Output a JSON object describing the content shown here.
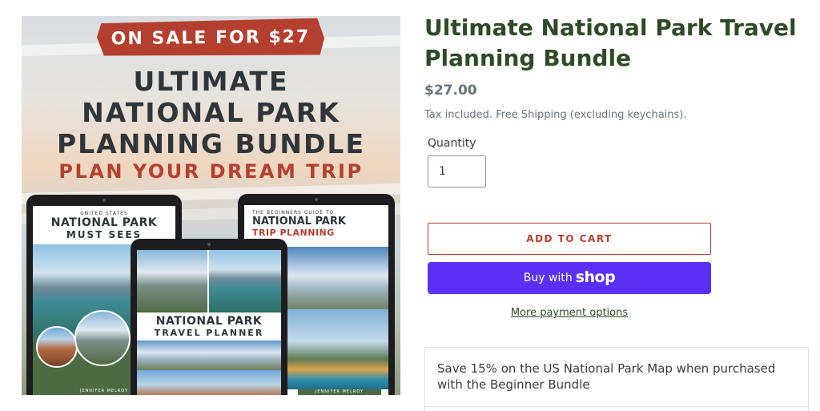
{
  "product_image": {
    "sale_banner": "ON SALE FOR $27",
    "title_line_1": "ULTIMATE",
    "title_line_2": "NATIONAL PARK",
    "title_line_3": "PLANNING BUNDLE",
    "tagline": "PLAN YOUR DREAM TRIP",
    "left_tablet": {
      "kicker": "UNITED STATES",
      "title": "NATIONAL PARK",
      "subtitle": "MUST SEES",
      "author": "JENNIFER MELROY"
    },
    "right_tablet": {
      "kicker": "THE BEGINNERS GUIDE TO",
      "title": "NATIONAL PARK",
      "subtitle": "TRIP PLANNING"
    },
    "middle_tablet": {
      "title": "NATIONAL PARK",
      "subtitle": "TRAVEL PLANNER",
      "author": "JENNIFER MELROY"
    }
  },
  "product": {
    "title": "Ultimate National Park Travel Planning Bundle",
    "price": "$27.00",
    "tax_note": "Tax included. Free Shipping (excluding keychains)."
  },
  "quantity": {
    "label": "Quantity",
    "value": "1"
  },
  "actions": {
    "add_to_cart": "ADD TO CART",
    "buy_with": "Buy with",
    "shop_brand": "shop",
    "more_payment_options": "More payment options"
  },
  "promo": {
    "text": "Save 15% on the US National Park Map when purchased with the Beginner Bundle"
  },
  "colors": {
    "title_green": "#2f4a27",
    "accent_red": "#b53f2f",
    "shop_purple": "#5a31f4",
    "price_gray": "#69727b"
  }
}
